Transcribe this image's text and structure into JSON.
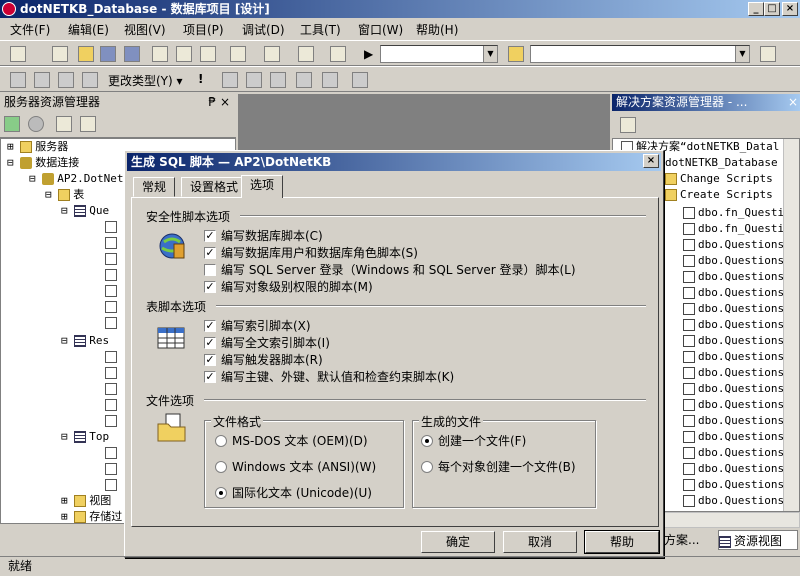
{
  "window": {
    "title": "dotNETKB_Database - 数据库项目 [设计]"
  },
  "menu": [
    "文件(F)",
    "编辑(E)",
    "视图(V)",
    "项目(P)",
    "调试(D)",
    "工具(T)",
    "窗口(W)",
    "帮助(H)"
  ],
  "toolbar2": {
    "change_type": "更改类型(Y) ▾"
  },
  "server_explorer": {
    "title": "服务器资源管理器",
    "items": [
      "服务器",
      "数据连接",
      "AP2.DotNet",
      "表",
      "Que",
      "Res",
      "Top",
      "视图",
      "存储过"
    ]
  },
  "solution_explorer": {
    "title": "解决方案资源管理器 - ...",
    "solution": "解决方案“dotNETKB_Datal",
    "project": "dotNETKB_Database",
    "folders": [
      "Change Scripts",
      "Create Scripts"
    ],
    "files": [
      "dbo.fn_Questio",
      "dbo.fn_Questio",
      "dbo.Questions.",
      "dbo.Questions.",
      "dbo.Questions.",
      "dbo.Questions.",
      "dbo.QuestionsG",
      "dbo.QuestionsG",
      "dbo.QuestionsG",
      "dbo.QuestionsG",
      "dbo.QuestionsG",
      "dbo.QuestionsG",
      "dbo.QuestionsG",
      "dbo.QuestionsG",
      "dbo.QuestionsG",
      "dbo.QuestionsG",
      "dbo.QuestionsG",
      "dbo.QuestionsG",
      "dbo.QuestionsR"
    ],
    "tab1": "方案...",
    "tab2": "资源视图"
  },
  "dialog": {
    "title": "生成 SQL 脚本 — AP2\\DotNetKB",
    "tabs": [
      "常规",
      "设置格式",
      "选项"
    ],
    "security": {
      "heading": "安全性脚本选项",
      "options": [
        {
          "label": "编写数据库脚本(C)",
          "checked": true
        },
        {
          "label": "编写数据库用户和数据库角色脚本(S)",
          "checked": true
        },
        {
          "label": "编写 SQL Server 登录（Windows 和 SQL Server 登录）脚本(L)",
          "checked": false
        },
        {
          "label": "编写对象级别权限的脚本(M)",
          "checked": true
        }
      ]
    },
    "table": {
      "heading": "表脚本选项",
      "options": [
        {
          "label": "编写索引脚本(X)",
          "checked": true
        },
        {
          "label": "编写全文索引脚本(I)",
          "checked": true
        },
        {
          "label": "编写触发器脚本(R)",
          "checked": true
        },
        {
          "label": "编写主键、外键、默认值和检查约束脚本(K)",
          "checked": true
        }
      ]
    },
    "file": {
      "heading": "文件选项",
      "format_label": "文件格式",
      "formats": [
        {
          "label": "MS-DOS 文本 (OEM)(D)",
          "selected": false
        },
        {
          "label": "Windows 文本 (ANSI)(W)",
          "selected": false
        },
        {
          "label": "国际化文本 (Unicode)(U)",
          "selected": true
        }
      ],
      "generated_label": "生成的文件",
      "generated": [
        {
          "label": "创建一个文件(F)",
          "selected": true
        },
        {
          "label": "每个对象创建一个文件(B)",
          "selected": false
        }
      ]
    },
    "buttons": {
      "ok": "确定",
      "cancel": "取消",
      "help": "帮助"
    }
  },
  "status": "就绪"
}
